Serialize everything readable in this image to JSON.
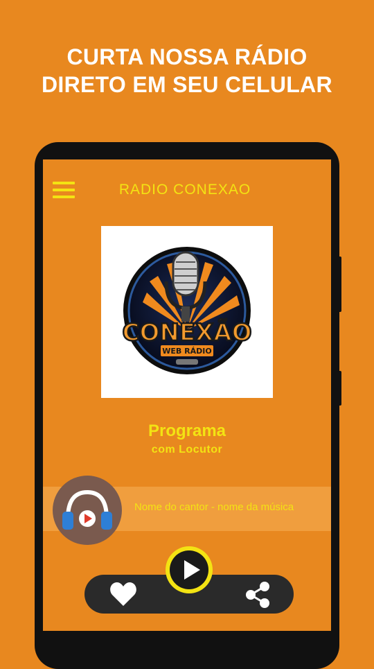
{
  "promo": {
    "line1": "CURTA NOSSA RÁDIO",
    "line2": "DIRETO EM SEU CELULAR"
  },
  "app": {
    "title": "RADIO CONEXAO",
    "menu_icon": "hamburger-menu-icon"
  },
  "logo": {
    "brand": "CONEXÃO",
    "tagline": "WEB RÁDIO"
  },
  "program": {
    "title": "Programa",
    "subtitle": "com Locutor"
  },
  "now_playing": {
    "text": "Nome do cantor - nome da música"
  },
  "controls": {
    "favorite_icon": "heart-icon",
    "play_icon": "play-icon",
    "share_icon": "share-icon",
    "headphone_icon": "headphones-icon"
  },
  "colors": {
    "background": "#E8881F",
    "accent": "#F3E313",
    "dark": "#2a2a2a",
    "badge": "#7a5a4e"
  }
}
